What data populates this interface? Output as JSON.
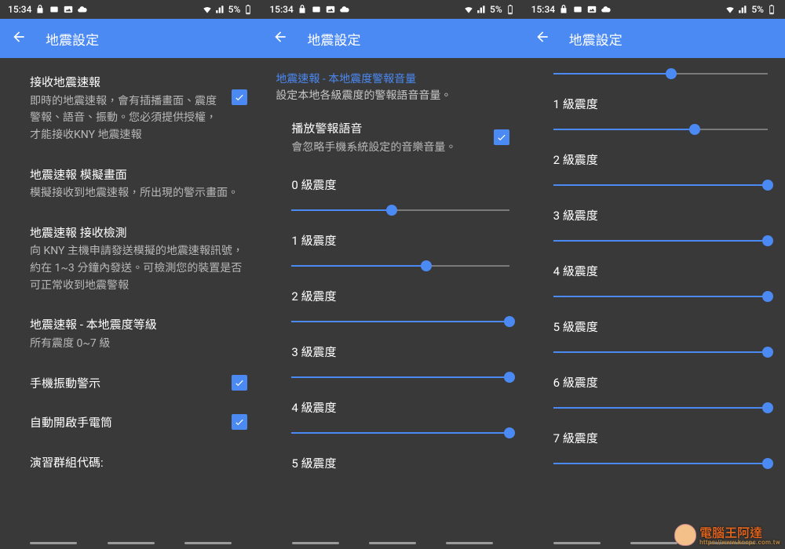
{
  "status": {
    "time": "15:34",
    "battery": "5%"
  },
  "app_title": "地震設定",
  "phone1": {
    "s1_title": "接收地震速報",
    "s1_desc": "即時的地震速報，會有插播畫面、震度警報、語音、振動。您必須提供授權，才能接收KNY 地震速報",
    "s2_title": "地震速報 模擬畫面",
    "s2_desc": "模擬接收到地震速報，所出現的警示畫面。",
    "s3_title": "地震速報 接收檢測",
    "s3_desc": "向 KNY 主機申請發送模擬的地震速報訊號，約在 1~3 分鐘內發送。可檢測您的裝置是否可正常收到地震警報",
    "s4_title": "地震速報 - 本地震度等級",
    "s4_desc": "所有震度 0~7 級",
    "s5_title": "手機振動警示",
    "s6_title": "自動開啟手電筒",
    "s7_title": "演習群組代碼:"
  },
  "phone2": {
    "header": "地震速報 - 本地震度警報音量",
    "header_sub": "設定本地各級震度的警報語音音量。",
    "play_title": "播放警報語音",
    "play_desc": "會忽略手機系統設定的音樂音量。",
    "sliders": [
      {
        "label": "0 級震度",
        "value": 46
      },
      {
        "label": "1 級震度",
        "value": 62
      },
      {
        "label": "2 級震度",
        "value": 100
      },
      {
        "label": "3 級震度",
        "value": 100
      },
      {
        "label": "4 級震度",
        "value": 100
      },
      {
        "label": "5 級震度"
      }
    ]
  },
  "phone3": {
    "top_value": 55,
    "sliders": [
      {
        "label": "1 級震度",
        "value": 66
      },
      {
        "label": "2 級震度",
        "value": 100
      },
      {
        "label": "3 級震度",
        "value": 100
      },
      {
        "label": "4 級震度",
        "value": 100
      },
      {
        "label": "5 級震度",
        "value": 100
      },
      {
        "label": "6 級震度",
        "value": 100
      },
      {
        "label": "7 級震度",
        "value": 100
      }
    ]
  },
  "watermark": {
    "title": "電腦王阿達",
    "url": "https://www.kocpc.com.tw"
  }
}
